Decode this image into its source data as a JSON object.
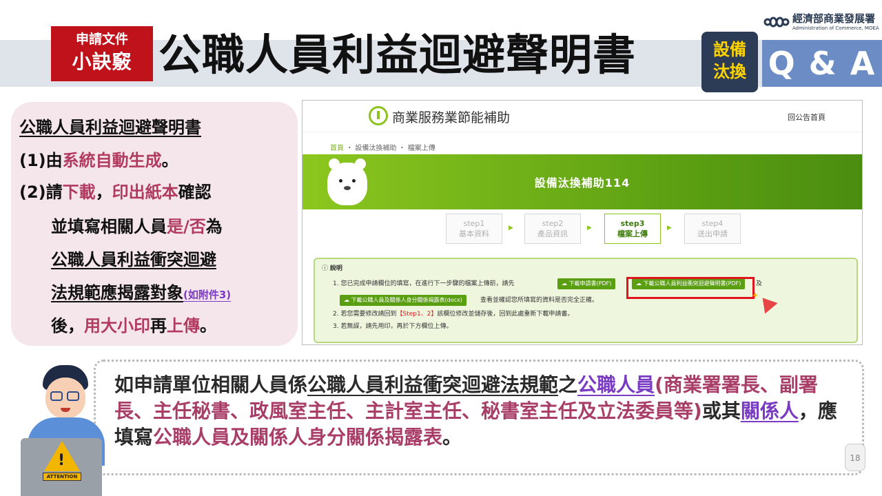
{
  "header": {
    "tag_line1": "申請文件",
    "tag_line2": "小訣竅",
    "title": "公職人員利益迴避聲明書",
    "logo_zh": "經濟部商業發展署",
    "logo_en": "Administration of Commerce, MOEA",
    "equip_line1": "設備",
    "equip_line2": "汰換",
    "qa": "Q & A"
  },
  "left_card": {
    "heading": "公職人員利益迴避聲明書",
    "item1_prefix": "(1)由",
    "item1_hl": "系統自動生成",
    "item1_end": "。",
    "item2_prefix": "(2)請",
    "item2_hl1": "下載",
    "item2_sep": "，",
    "item2_hl2": "印出紙本",
    "item2_end": "確認",
    "line3_a": "並填寫相關人員",
    "line3_hl": "是/否",
    "line3_b": "為",
    "line4": "公職人員利益衝突迴避",
    "line5": "法規範應揭露對象",
    "line5_small": "(如附件3)",
    "line6_a": "後，",
    "line6_hl1": "用大小印",
    "line6_b": "再",
    "line6_hl2": "上傳",
    "line6_end": "。"
  },
  "screenshot": {
    "site_name": "商業服務業節能補助",
    "home_link": "回公告首頁",
    "crumb_home": "首頁",
    "crumb_rest": "・ 設備汰換補助 ・ 檔案上傳",
    "banner_title": "設備汰換補助114",
    "steps": [
      {
        "title": "step1",
        "sub": "基本資料"
      },
      {
        "title": "step2",
        "sub": "產品資訊"
      },
      {
        "title": "step3",
        "sub": "檔案上傳"
      },
      {
        "title": "step4",
        "sub": "送出申請"
      }
    ],
    "note_title": "說明",
    "note_line1": "1. 您已完成申請欄位的填寫，在進行下一步驟的檔案上傳前，請先",
    "btn_download_app": "下載申請書(PDF)",
    "btn_download_statement": "下載公職人員利益衝突迴避聲明書(PDF)",
    "note_line1_end": "及",
    "btn_download_form": "下載公職人員及關係人身分關係揭露表(docx)",
    "note_line1b": "查看並確認您所填寫的資料是否完全正確。",
    "note_line2_a": "2. 若您需要修改請回到",
    "note_line2_hl": "【Step1、2】",
    "note_line2_b": "該欄位修改並儲存後，回到此處重新下載申請書。",
    "note_line3": "3. 若無誤，請先用印，再於下方欄位上傳。"
  },
  "bottom": {
    "t1": "如申請單位相關人員係",
    "t2": "公職人員利益衝突迴避法規範",
    "t3": "之",
    "t4": "公職人員",
    "t5": "(商業署署長、副署長、主任秘書、政風室主任、主計室主任、秘書室主任及立法委員等)",
    "t6": "或其",
    "t7": "關係人",
    "t8": "，應填寫",
    "t9": "公職人員及關係人身分關係揭露表",
    "t10": "。"
  },
  "attention_label": "ATTENTION",
  "page_number": "18"
}
